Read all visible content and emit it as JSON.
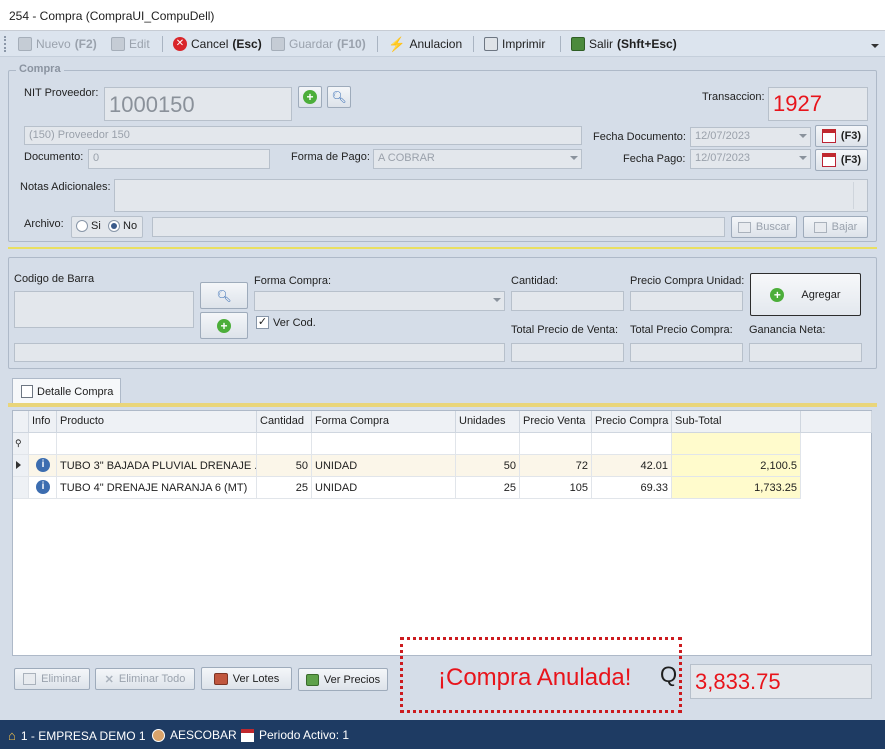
{
  "window": {
    "title": "254 - Compra (CompraUI_CompuDell)"
  },
  "toolbar": {
    "nuevo": "Nuevo",
    "nuevo_key": "(F2)",
    "edit": "Edit",
    "cancel": "Cancel",
    "cancel_key": "(Esc)",
    "guardar": "Guardar",
    "guardar_key": "(F10)",
    "anulacion": "Anulacion",
    "imprimir": "Imprimir",
    "salir": "Salir",
    "salir_key": "(Shft+Esc)"
  },
  "compra": {
    "legend": "Compra",
    "nit_label": "NIT Proveedor:",
    "nit_value": "1000150",
    "proveedor": "(150) Proveedor 150",
    "transaccion_label": "Transaccion:",
    "transaccion": "1927",
    "fecha_doc_label": "Fecha Documento:",
    "fecha_doc": "12/07/2023",
    "fecha_pago_label": "Fecha Pago:",
    "fecha_pago": "12/07/2023",
    "f3": "(F3)",
    "documento_label": "Documento:",
    "documento": "0",
    "forma_pago_label": "Forma de Pago:",
    "forma_pago": "A COBRAR",
    "notas_label": "Notas Adicionales:",
    "archivo_label": "Archivo:",
    "si": "Si",
    "no": "No",
    "buscar": "Buscar",
    "bajar": "Bajar"
  },
  "entry": {
    "codigo_label": "Codigo de Barra",
    "forma_compra_label": "Forma Compra:",
    "ver_cod": "Ver Cod.",
    "cantidad_label": "Cantidad:",
    "precio_unidad_label": "Precio Compra Unidad:",
    "agregar": "Agregar",
    "total_venta_label": "Total Precio de Venta:",
    "total_compra_label": "Total Precio Compra:",
    "ganancia_label": "Ganancia Neta:"
  },
  "tab": {
    "label": "Detalle Compra"
  },
  "grid": {
    "headers": [
      "Info",
      "Producto",
      "Cantidad",
      "Forma Compra",
      "Unidades",
      "Precio Venta",
      "Precio Compra",
      "Sub-Total"
    ],
    "rows": [
      {
        "producto": "TUBO 3\" BAJADA PLUVIAL DRENAJE ...",
        "cantidad": "50",
        "forma": "UNIDAD",
        "unidades": "50",
        "precio_venta": "72",
        "precio_compra": "42.01",
        "subtotal": "2,100.5"
      },
      {
        "producto": "TUBO 4\" DRENAJE NARANJA 6 (MT)",
        "cantidad": "25",
        "forma": "UNIDAD",
        "unidades": "25",
        "precio_venta": "105",
        "precio_compra": "69.33",
        "subtotal": "1,733.25"
      }
    ]
  },
  "bottom": {
    "eliminar": "Eliminar",
    "eliminar_todo": "Eliminar Todo",
    "ver_lotes": "Ver Lotes",
    "ver_precios": "Ver Precios",
    "anulada": "¡Compra Anulada!",
    "currency": "Q",
    "total": "3,833.75"
  },
  "status": {
    "empresa": "1 - EMPRESA DEMO 1",
    "user": "AESCOBAR",
    "periodo": "Periodo Activo: 1"
  },
  "colors": {
    "accent_red": "#e8141b",
    "status_bar": "#1e3b63",
    "highlight_yellow": "#fffbcc"
  }
}
